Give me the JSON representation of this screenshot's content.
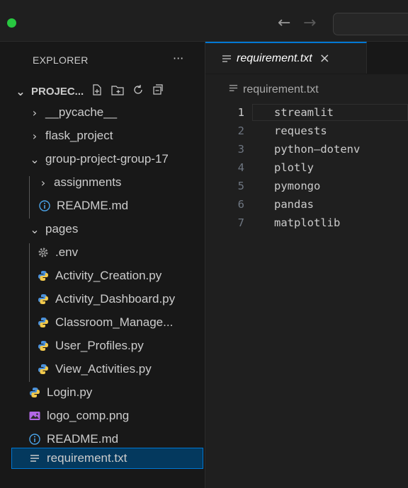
{
  "window": {
    "back_arrow": "←",
    "forward_arrow": "→",
    "status_color": "#28c840"
  },
  "sidebar": {
    "header": "EXPLORER",
    "more": "···",
    "root": {
      "label": "PROJEC...",
      "expanded": true
    },
    "items": [
      {
        "label": "__pycache__",
        "kind": "folder",
        "expanded": false
      },
      {
        "label": "flask_project",
        "kind": "folder",
        "expanded": false
      },
      {
        "label": "group-project-group-17",
        "kind": "folder",
        "expanded": true
      },
      {
        "label": "assignments",
        "kind": "folder",
        "expanded": false
      },
      {
        "label": "README.md",
        "kind": "info"
      },
      {
        "label": "pages",
        "kind": "folder",
        "expanded": true
      },
      {
        "label": ".env",
        "kind": "gear"
      },
      {
        "label": "Activity_Creation.py",
        "kind": "python"
      },
      {
        "label": "Activity_Dashboard.py",
        "kind": "python"
      },
      {
        "label": "Classroom_Manage...",
        "kind": "python"
      },
      {
        "label": "User_Profiles.py",
        "kind": "python"
      },
      {
        "label": "View_Activities.py",
        "kind": "python"
      },
      {
        "label": "Login.py",
        "kind": "python"
      },
      {
        "label": "logo_comp.png",
        "kind": "image"
      },
      {
        "label": "README.md",
        "kind": "info"
      },
      {
        "label": "requirement.txt",
        "kind": "text",
        "selected": true
      }
    ]
  },
  "editor": {
    "tab_label": "requirement.txt",
    "tab_close": "×",
    "breadcrumb": "requirement.txt",
    "current_line": 1,
    "lines": [
      {
        "num": "1",
        "text": "streamlit"
      },
      {
        "num": "2",
        "text": "requests"
      },
      {
        "num": "3",
        "text": "python–dotenv"
      },
      {
        "num": "4",
        "text": "plotly"
      },
      {
        "num": "5",
        "text": "pymongo"
      },
      {
        "num": "6",
        "text": "pandas"
      },
      {
        "num": "7",
        "text": "matplotlib"
      }
    ]
  }
}
